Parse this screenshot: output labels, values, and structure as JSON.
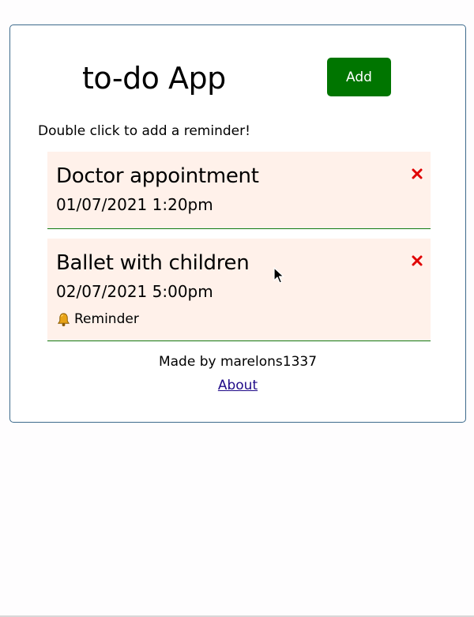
{
  "header": {
    "title": "to-do App",
    "add_label": "Add"
  },
  "hint": "Double click to add a reminder!",
  "tasks": [
    {
      "title": "Doctor appointment",
      "date": "01/07/2021 1:20pm",
      "reminder": false,
      "delete_icon": "close-x-icon"
    },
    {
      "title": "Ballet with children",
      "date": "02/07/2021 5:00pm",
      "reminder": true,
      "reminder_label": "Reminder",
      "reminder_icon": "bell-icon",
      "delete_icon": "close-x-icon"
    }
  ],
  "footer": {
    "made_by": "Made by marelons1337",
    "about_label": "About"
  },
  "colors": {
    "add_button": "#007500",
    "task_background": "#fff1ea",
    "task_border": "#127a12",
    "delete_icon": "#e00000",
    "frame_border": "#3d6a8c",
    "link": "#1f0a88"
  }
}
